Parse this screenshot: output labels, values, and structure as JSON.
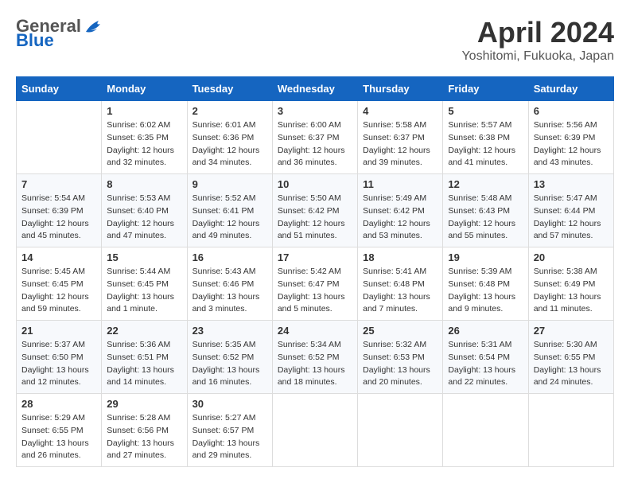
{
  "header": {
    "logo_general": "General",
    "logo_blue": "Blue",
    "month_title": "April 2024",
    "location": "Yoshitomi, Fukuoka, Japan"
  },
  "weekdays": [
    "Sunday",
    "Monday",
    "Tuesday",
    "Wednesday",
    "Thursday",
    "Friday",
    "Saturday"
  ],
  "weeks": [
    [
      {
        "day": "",
        "info": ""
      },
      {
        "day": "1",
        "info": "Sunrise: 6:02 AM\nSunset: 6:35 PM\nDaylight: 12 hours\nand 32 minutes."
      },
      {
        "day": "2",
        "info": "Sunrise: 6:01 AM\nSunset: 6:36 PM\nDaylight: 12 hours\nand 34 minutes."
      },
      {
        "day": "3",
        "info": "Sunrise: 6:00 AM\nSunset: 6:37 PM\nDaylight: 12 hours\nand 36 minutes."
      },
      {
        "day": "4",
        "info": "Sunrise: 5:58 AM\nSunset: 6:37 PM\nDaylight: 12 hours\nand 39 minutes."
      },
      {
        "day": "5",
        "info": "Sunrise: 5:57 AM\nSunset: 6:38 PM\nDaylight: 12 hours\nand 41 minutes."
      },
      {
        "day": "6",
        "info": "Sunrise: 5:56 AM\nSunset: 6:39 PM\nDaylight: 12 hours\nand 43 minutes."
      }
    ],
    [
      {
        "day": "7",
        "info": "Sunrise: 5:54 AM\nSunset: 6:39 PM\nDaylight: 12 hours\nand 45 minutes."
      },
      {
        "day": "8",
        "info": "Sunrise: 5:53 AM\nSunset: 6:40 PM\nDaylight: 12 hours\nand 47 minutes."
      },
      {
        "day": "9",
        "info": "Sunrise: 5:52 AM\nSunset: 6:41 PM\nDaylight: 12 hours\nand 49 minutes."
      },
      {
        "day": "10",
        "info": "Sunrise: 5:50 AM\nSunset: 6:42 PM\nDaylight: 12 hours\nand 51 minutes."
      },
      {
        "day": "11",
        "info": "Sunrise: 5:49 AM\nSunset: 6:42 PM\nDaylight: 12 hours\nand 53 minutes."
      },
      {
        "day": "12",
        "info": "Sunrise: 5:48 AM\nSunset: 6:43 PM\nDaylight: 12 hours\nand 55 minutes."
      },
      {
        "day": "13",
        "info": "Sunrise: 5:47 AM\nSunset: 6:44 PM\nDaylight: 12 hours\nand 57 minutes."
      }
    ],
    [
      {
        "day": "14",
        "info": "Sunrise: 5:45 AM\nSunset: 6:45 PM\nDaylight: 12 hours\nand 59 minutes."
      },
      {
        "day": "15",
        "info": "Sunrise: 5:44 AM\nSunset: 6:45 PM\nDaylight: 13 hours\nand 1 minute."
      },
      {
        "day": "16",
        "info": "Sunrise: 5:43 AM\nSunset: 6:46 PM\nDaylight: 13 hours\nand 3 minutes."
      },
      {
        "day": "17",
        "info": "Sunrise: 5:42 AM\nSunset: 6:47 PM\nDaylight: 13 hours\nand 5 minutes."
      },
      {
        "day": "18",
        "info": "Sunrise: 5:41 AM\nSunset: 6:48 PM\nDaylight: 13 hours\nand 7 minutes."
      },
      {
        "day": "19",
        "info": "Sunrise: 5:39 AM\nSunset: 6:48 PM\nDaylight: 13 hours\nand 9 minutes."
      },
      {
        "day": "20",
        "info": "Sunrise: 5:38 AM\nSunset: 6:49 PM\nDaylight: 13 hours\nand 11 minutes."
      }
    ],
    [
      {
        "day": "21",
        "info": "Sunrise: 5:37 AM\nSunset: 6:50 PM\nDaylight: 13 hours\nand 12 minutes."
      },
      {
        "day": "22",
        "info": "Sunrise: 5:36 AM\nSunset: 6:51 PM\nDaylight: 13 hours\nand 14 minutes."
      },
      {
        "day": "23",
        "info": "Sunrise: 5:35 AM\nSunset: 6:52 PM\nDaylight: 13 hours\nand 16 minutes."
      },
      {
        "day": "24",
        "info": "Sunrise: 5:34 AM\nSunset: 6:52 PM\nDaylight: 13 hours\nand 18 minutes."
      },
      {
        "day": "25",
        "info": "Sunrise: 5:32 AM\nSunset: 6:53 PM\nDaylight: 13 hours\nand 20 minutes."
      },
      {
        "day": "26",
        "info": "Sunrise: 5:31 AM\nSunset: 6:54 PM\nDaylight: 13 hours\nand 22 minutes."
      },
      {
        "day": "27",
        "info": "Sunrise: 5:30 AM\nSunset: 6:55 PM\nDaylight: 13 hours\nand 24 minutes."
      }
    ],
    [
      {
        "day": "28",
        "info": "Sunrise: 5:29 AM\nSunset: 6:55 PM\nDaylight: 13 hours\nand 26 minutes."
      },
      {
        "day": "29",
        "info": "Sunrise: 5:28 AM\nSunset: 6:56 PM\nDaylight: 13 hours\nand 27 minutes."
      },
      {
        "day": "30",
        "info": "Sunrise: 5:27 AM\nSunset: 6:57 PM\nDaylight: 13 hours\nand 29 minutes."
      },
      {
        "day": "",
        "info": ""
      },
      {
        "day": "",
        "info": ""
      },
      {
        "day": "",
        "info": ""
      },
      {
        "day": "",
        "info": ""
      }
    ]
  ]
}
